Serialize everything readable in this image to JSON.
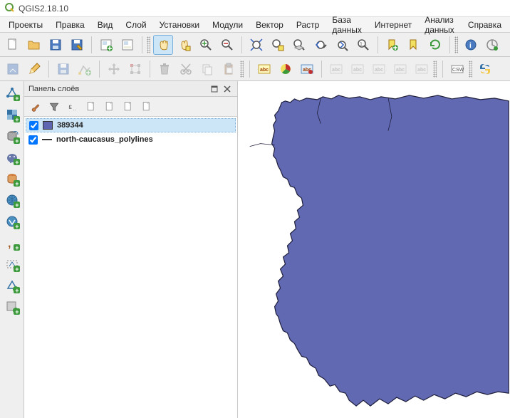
{
  "app": {
    "title": "QGIS2.18.10"
  },
  "menu": {
    "items": [
      "Проекты",
      "Правка",
      "Вид",
      "Слой",
      "Установки",
      "Модули",
      "Вектор",
      "Растр",
      "База данных",
      "Интернет",
      "Анализ данных",
      "Справка"
    ]
  },
  "toolbar1": {
    "tools": [
      {
        "name": "new-project-icon",
        "kind": "doc"
      },
      {
        "name": "open-project-icon",
        "kind": "folder"
      },
      {
        "name": "save-project-icon",
        "kind": "save"
      },
      {
        "name": "save-as-icon",
        "kind": "save-pen"
      },
      {
        "sep": true
      },
      {
        "name": "new-print-composer-icon",
        "kind": "composer-plus"
      },
      {
        "name": "composer-manager-icon",
        "kind": "composer"
      },
      {
        "sep": true
      },
      {
        "grip": true
      },
      {
        "name": "pan-icon",
        "kind": "hand",
        "active": true
      },
      {
        "name": "pan-selection-icon",
        "kind": "hand-sel"
      },
      {
        "name": "zoom-in-icon",
        "kind": "zoom-in"
      },
      {
        "name": "zoom-out-icon",
        "kind": "zoom-out"
      },
      {
        "sep": true
      },
      {
        "name": "zoom-full-icon",
        "kind": "zoom-full"
      },
      {
        "name": "zoom-selection-icon",
        "kind": "zoom-sel"
      },
      {
        "name": "zoom-layer-icon",
        "kind": "zoom-layer"
      },
      {
        "name": "zoom-last-icon",
        "kind": "zoom-last"
      },
      {
        "name": "zoom-next-icon",
        "kind": "zoom-next"
      },
      {
        "name": "zoom-native-icon",
        "kind": "zoom-native"
      },
      {
        "sep": true
      },
      {
        "name": "new-bookmark-icon",
        "kind": "bookmark-new"
      },
      {
        "name": "show-bookmarks-icon",
        "kind": "bookmark"
      },
      {
        "name": "refresh-icon",
        "kind": "refresh"
      },
      {
        "sep": true
      },
      {
        "grip": true
      },
      {
        "name": "identify-icon",
        "kind": "identify"
      },
      {
        "name": "run-feature-action-icon",
        "kind": "action"
      }
    ]
  },
  "toolbar2": {
    "tools": [
      {
        "name": "current-edits-icon",
        "kind": "edits",
        "disabled": true
      },
      {
        "name": "toggle-editing-icon",
        "kind": "pencil"
      },
      {
        "sep": true
      },
      {
        "name": "save-layer-edits-icon",
        "kind": "save",
        "disabled": true
      },
      {
        "name": "add-feature-icon",
        "kind": "add-feat",
        "disabled": true
      },
      {
        "sep": true
      },
      {
        "name": "move-feature-icon",
        "kind": "move",
        "disabled": true
      },
      {
        "name": "node-tool-icon",
        "kind": "node",
        "disabled": true
      },
      {
        "sep": true
      },
      {
        "name": "delete-selected-icon",
        "kind": "trash",
        "disabled": true
      },
      {
        "name": "cut-features-icon",
        "kind": "cut",
        "disabled": true
      },
      {
        "name": "copy-features-icon",
        "kind": "copy",
        "disabled": true
      },
      {
        "name": "paste-features-icon",
        "kind": "paste",
        "disabled": true
      },
      {
        "grip": true
      },
      {
        "sep": true
      },
      {
        "name": "label-icon",
        "kind": "abc-y"
      },
      {
        "name": "label-settings-icon",
        "kind": "pie"
      },
      {
        "name": "highlight-labels-icon",
        "kind": "abc-b"
      },
      {
        "sep": true
      },
      {
        "name": "pin-labels-icon",
        "kind": "abc-g",
        "disabled": true
      },
      {
        "name": "show-hide-labels-icon",
        "kind": "abc-g",
        "disabled": true
      },
      {
        "name": "move-label-icon",
        "kind": "abc-g",
        "disabled": true
      },
      {
        "name": "rotate-label-icon",
        "kind": "abc-g",
        "disabled": true
      },
      {
        "name": "change-label-icon",
        "kind": "abc-g",
        "disabled": true
      },
      {
        "grip": true
      },
      {
        "sep": true
      },
      {
        "name": "csw-client-icon",
        "kind": "csw",
        "label": "CSW"
      },
      {
        "grip": true
      },
      {
        "name": "python-console-icon",
        "kind": "python"
      }
    ]
  },
  "sidebar_tools": [
    {
      "name": "add-vector-layer-icon",
      "kind": "v-layer"
    },
    {
      "name": "add-raster-layer-icon",
      "kind": "r-layer"
    },
    {
      "name": "add-spatialite-layer-icon",
      "kind": "db-feather"
    },
    {
      "name": "add-postgis-layer-icon",
      "kind": "elephant"
    },
    {
      "name": "add-mssql-layer-icon",
      "kind": "db-ms"
    },
    {
      "name": "add-wms-layer-icon",
      "kind": "globe"
    },
    {
      "name": "add-wfs-layer-icon",
      "kind": "globe-v"
    },
    {
      "name": "add-delimited-text-icon",
      "kind": "comma"
    },
    {
      "name": "add-virtual-layer-icon",
      "kind": "virtual"
    },
    {
      "name": "new-shapefile-icon",
      "kind": "v-new"
    },
    {
      "name": "new-geopackage-icon",
      "kind": "gp-new"
    }
  ],
  "layers_panel": {
    "title": "Панель слоёв",
    "tools": [
      {
        "name": "layer-style-icon",
        "kind": "brush"
      },
      {
        "name": "filter-legend-icon",
        "kind": "filter"
      },
      {
        "name": "expression-icon",
        "kind": "eps",
        "label": "ε.."
      }
    ],
    "layers": [
      {
        "checked": true,
        "swatch": "#5f66b1",
        "name": "389344",
        "selected": true
      },
      {
        "checked": true,
        "swatch": "line",
        "name": "north-caucasus_polylines",
        "selected": false
      }
    ]
  },
  "colors": {
    "region_fill": "#6169b3",
    "region_stroke": "#1e1e3b"
  }
}
